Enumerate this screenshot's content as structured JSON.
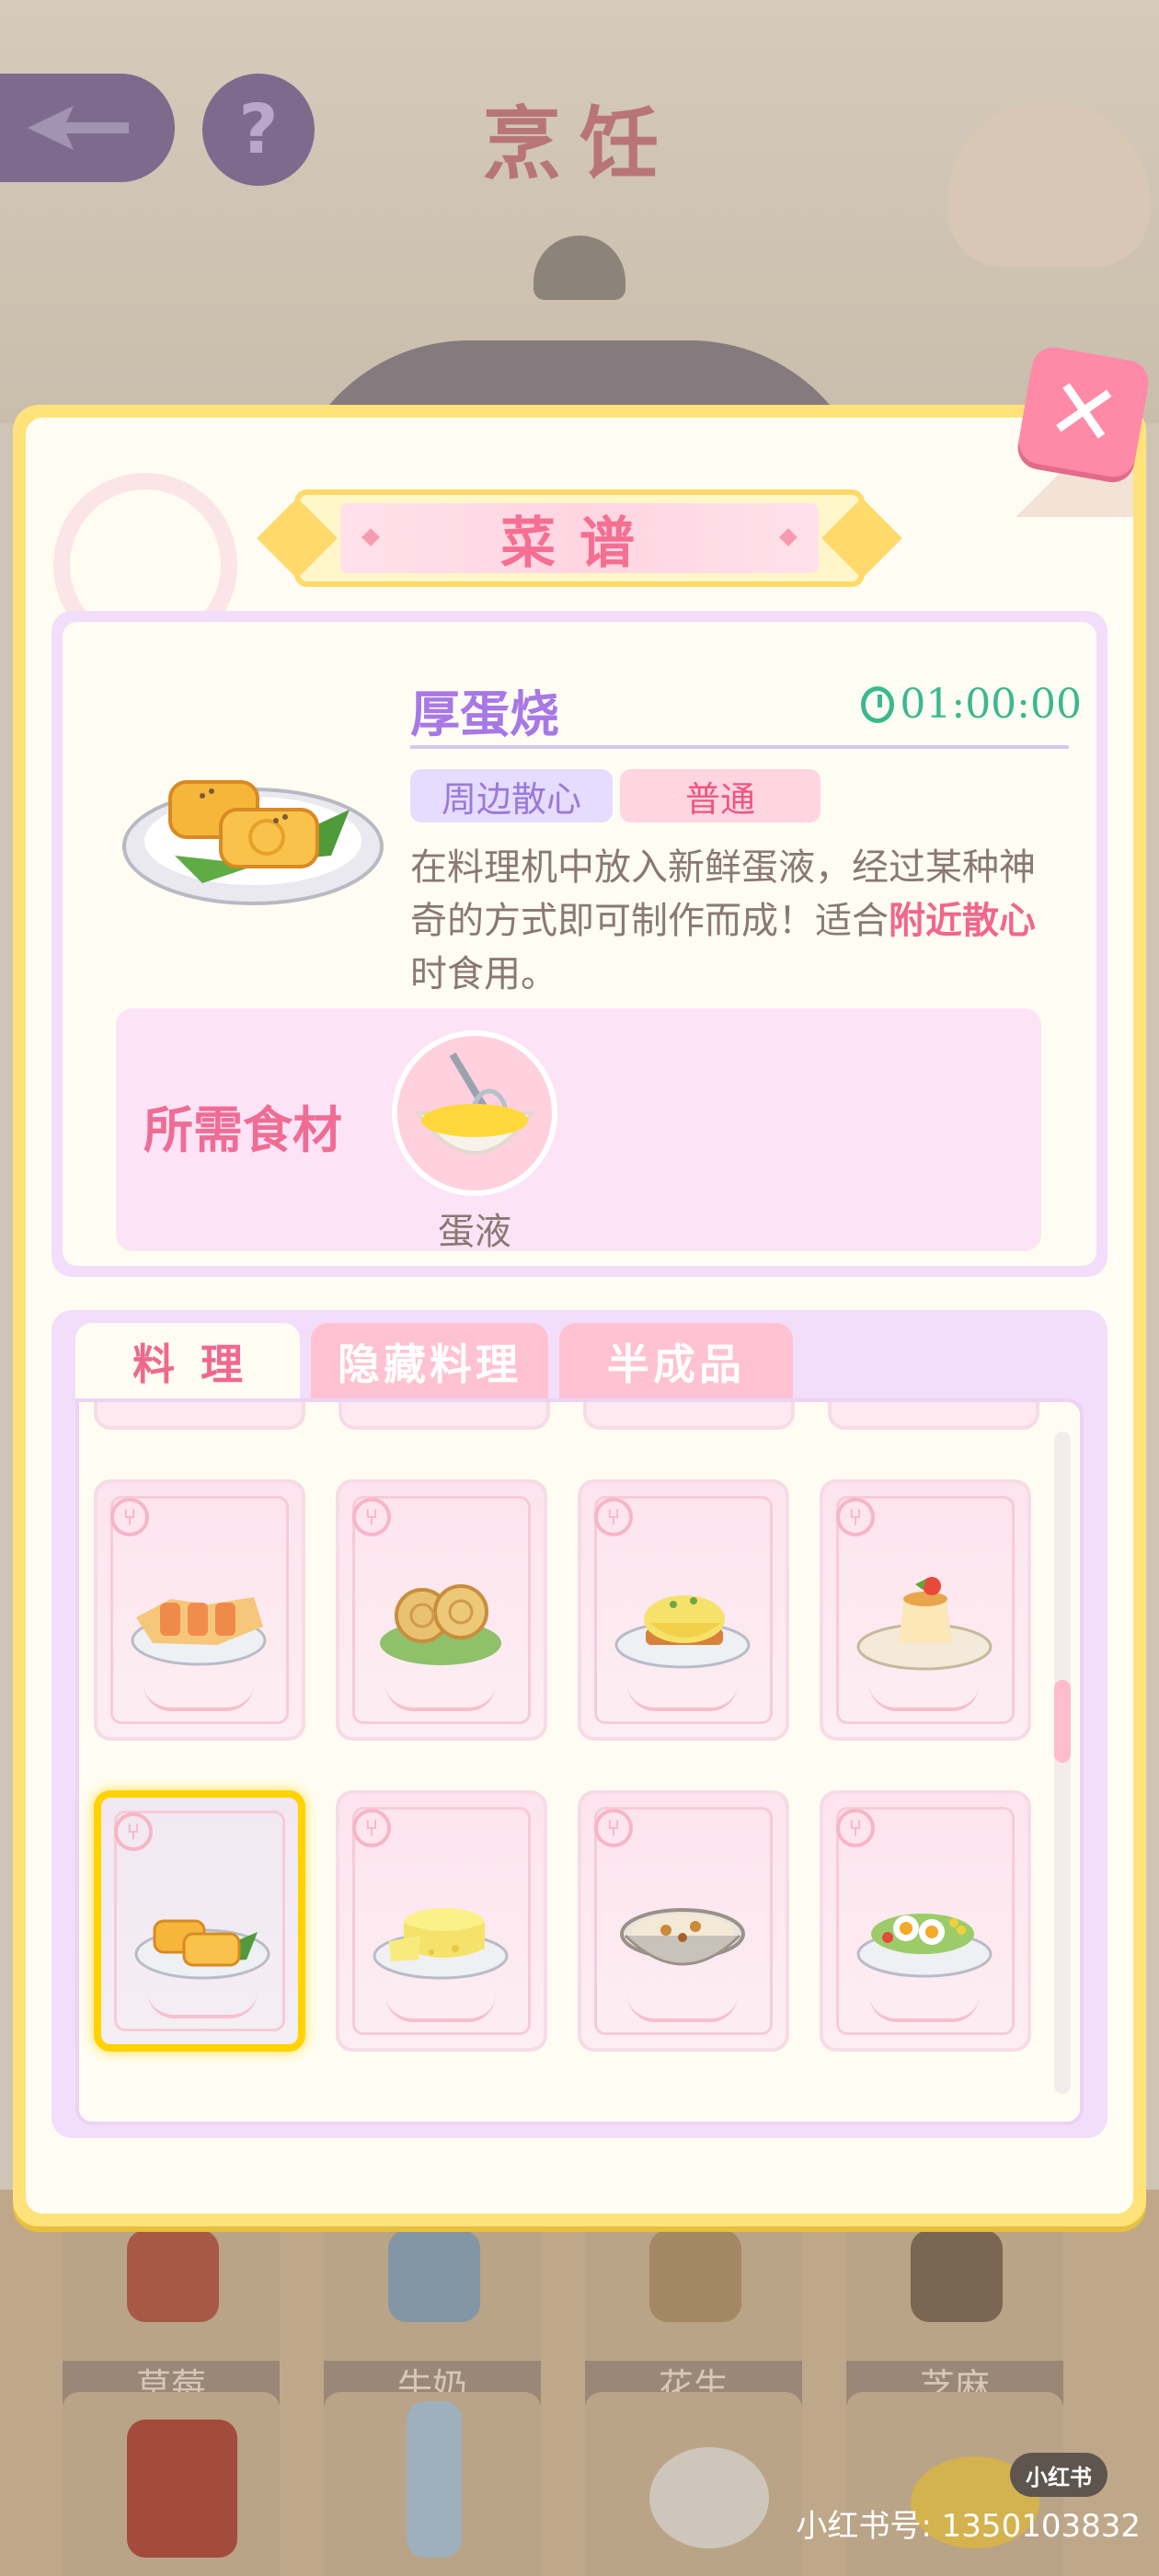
{
  "background": {
    "title": "烹饪",
    "ingredients_row1": [
      "草莓",
      "牛奶",
      "花生",
      "芝麻"
    ]
  },
  "modal": {
    "title": "菜谱",
    "close_label": "✕",
    "selected_dish": {
      "name": "厚蛋烧",
      "time": "01:00:00",
      "category": "周边散心",
      "rarity": "普通",
      "description_prefix": "在料理机中放入新鲜蛋液，经过某种神奇的方式即可制作而成！适合",
      "description_highlight": "附近散心",
      "description_suffix": "时食用。",
      "ingredients_label": "所需食材",
      "ingredients": [
        {
          "name": "蛋液",
          "icon": "egg-liquid-bowl-icon"
        }
      ]
    },
    "tabs": [
      {
        "label": "料理",
        "active": true
      },
      {
        "label": "隐藏料理",
        "active": false
      },
      {
        "label": "半成品",
        "active": false
      }
    ],
    "recipes": [
      {
        "icon": "egg-rolls-icon",
        "selected": false
      },
      {
        "icon": "veggie-rolls-icon",
        "selected": false
      },
      {
        "icon": "eggs-benedict-icon",
        "selected": false
      },
      {
        "icon": "pudding-icon",
        "selected": false
      },
      {
        "icon": "tamagoyaki-icon",
        "selected": true
      },
      {
        "icon": "cheese-wheel-icon",
        "selected": false
      },
      {
        "icon": "soup-bowl-icon",
        "selected": false
      },
      {
        "icon": "egg-salad-icon",
        "selected": false
      }
    ]
  },
  "watermark": {
    "badge": "小红书",
    "text": "小红书号: 1350103832"
  },
  "colors": {
    "modal_border": "#ffe37a",
    "accent_pink": "#f0688f",
    "accent_purple": "#a878e6",
    "timer_green": "#3bb98e",
    "selected_border": "#ffd200"
  }
}
